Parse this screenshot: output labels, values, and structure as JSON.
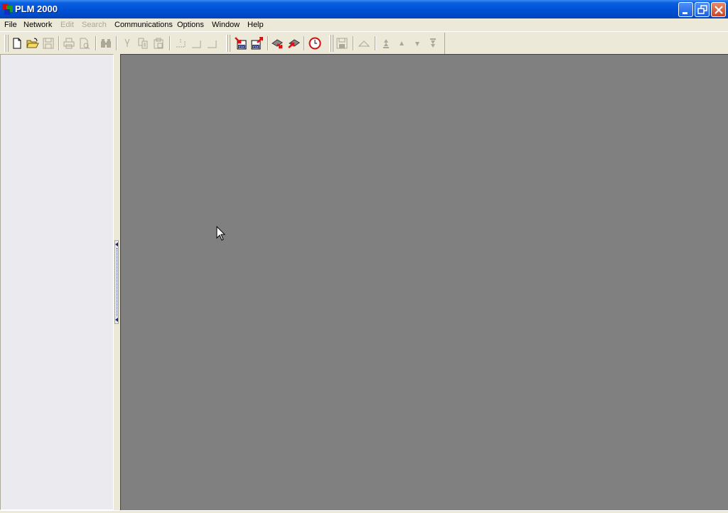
{
  "window": {
    "title": "PLM 2000",
    "controls": [
      "minimize",
      "restore",
      "close"
    ]
  },
  "menubar": {
    "items": [
      {
        "label": "File",
        "enabled": true
      },
      {
        "label": "Network",
        "enabled": true
      },
      {
        "label": "Edit",
        "enabled": false
      },
      {
        "label": "Search",
        "enabled": false
      },
      {
        "label": "Communications",
        "enabled": true
      },
      {
        "label": "Options",
        "enabled": true
      },
      {
        "label": "Window",
        "enabled": true
      },
      {
        "label": "Help",
        "enabled": true
      }
    ]
  },
  "toolbar": {
    "buttons": [
      {
        "icon": "new-document-icon",
        "enabled": true
      },
      {
        "icon": "open-folder-icon",
        "enabled": true
      },
      {
        "icon": "save-icon",
        "enabled": false
      },
      {
        "icon": "print-icon",
        "enabled": false
      },
      {
        "icon": "print-preview-icon",
        "enabled": false
      },
      {
        "icon": "find-binoculars-icon",
        "enabled": false
      },
      {
        "icon": "cut-icon",
        "enabled": false
      },
      {
        "icon": "copy-icon",
        "enabled": false
      },
      {
        "icon": "paste-icon",
        "enabled": false
      },
      {
        "icon": "insert-icon",
        "enabled": false
      },
      {
        "icon": "align-left-icon",
        "enabled": false
      },
      {
        "icon": "align-right-icon",
        "enabled": false
      },
      {
        "icon": "import-edf-icon",
        "enabled": true
      },
      {
        "icon": "export-edf-icon",
        "enabled": true
      },
      {
        "icon": "download-device-icon",
        "enabled": true
      },
      {
        "icon": "upload-device-icon",
        "enabled": true
      },
      {
        "icon": "clock-icon",
        "enabled": true
      },
      {
        "icon": "save-disk-icon",
        "enabled": false
      },
      {
        "icon": "collapse-icon",
        "enabled": false
      },
      {
        "icon": "move-top-icon",
        "enabled": false
      },
      {
        "icon": "move-up-icon",
        "enabled": false
      },
      {
        "icon": "move-down-icon",
        "enabled": false
      },
      {
        "icon": "move-bottom-icon",
        "enabled": false
      }
    ],
    "edf_label": "EDF"
  },
  "colors": {
    "titlebar": "#0052d6",
    "mdi_background": "#808080",
    "panel_background": "#ebeaef",
    "chrome": "#ece9d8"
  }
}
